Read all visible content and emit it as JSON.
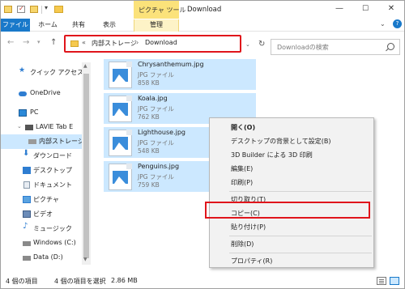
{
  "titlebar": {
    "context_tab": "ピクチャ ツール",
    "window_title": "Download",
    "min": "—",
    "max": "☐",
    "close": "✕"
  },
  "ribbon": {
    "tabs": [
      "ファイル",
      "ホーム",
      "共有",
      "表示"
    ],
    "manage_tab": "管理"
  },
  "navigation": {
    "back": "←",
    "forward": "→",
    "up": "↑",
    "address": {
      "prefix": "«",
      "segments": [
        "内部ストレージ",
        "Download"
      ],
      "separator": "›"
    },
    "search_placeholder": "Downloadの検索"
  },
  "sidebar": {
    "items": [
      {
        "label": "クイック アクセス",
        "icon": "star-icon"
      },
      {
        "label": "OneDrive",
        "icon": "cloud-icon"
      },
      {
        "label": "PC",
        "icon": "pc-icon"
      },
      {
        "label": "LAVIE Tab E",
        "icon": "device-icon"
      },
      {
        "label": "内部ストレージ",
        "icon": "drive-icon",
        "selected": true
      },
      {
        "label": "ダウンロード",
        "icon": "download-icon"
      },
      {
        "label": "デスクトップ",
        "icon": "desktop-icon"
      },
      {
        "label": "ドキュメント",
        "icon": "document-icon"
      },
      {
        "label": "ピクチャ",
        "icon": "pictures-icon"
      },
      {
        "label": "ビデオ",
        "icon": "video-icon"
      },
      {
        "label": "ミュージック",
        "icon": "music-icon"
      },
      {
        "label": "Windows (C:)",
        "icon": "windows-drive-icon"
      },
      {
        "label": "Data (D:)",
        "icon": "data-drive-icon"
      }
    ]
  },
  "files": [
    {
      "name": "Chrysanthemum.jpg",
      "type": "JPG ファイル",
      "size": "858 KB"
    },
    {
      "name": "Koala.jpg",
      "type": "JPG ファイル",
      "size": "762 KB"
    },
    {
      "name": "Lighthouse.jpg",
      "type": "JPG ファイル",
      "size": "548 KB"
    },
    {
      "name": "Penguins.jpg",
      "type": "JPG ファイル",
      "size": "759 KB"
    }
  ],
  "context_menu": {
    "open": "開く(O)",
    "set_background": "デスクトップの背景として設定(B)",
    "print_3d": "3D Builder による 3D 印刷",
    "edit": "編集(E)",
    "print": "印刷(P)",
    "cut": "切り取り(T)",
    "copy": "コピー(C)",
    "paste": "貼り付け(P)",
    "delete": "削除(D)",
    "properties": "プロパティ(R)"
  },
  "status": {
    "count": "4 個の項目",
    "selected": "4 個の項目を選択",
    "size": "2.86 MB"
  },
  "colors": {
    "accent": "#1979ca",
    "selection": "#cce8ff",
    "highlight_frame": "#e0151b",
    "context_tab": "#fbe27a"
  }
}
